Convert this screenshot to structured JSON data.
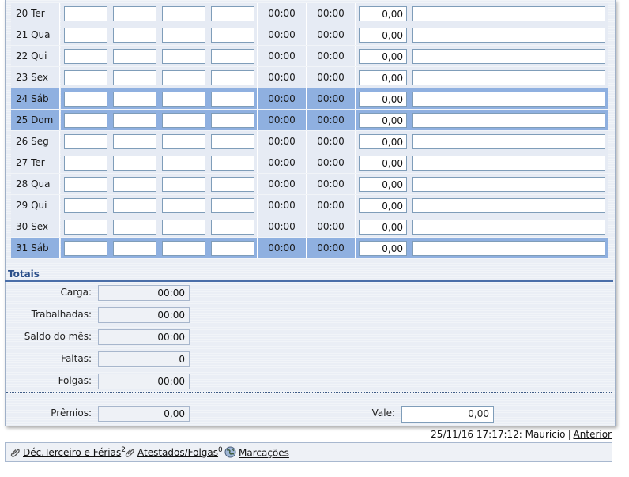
{
  "rows": [
    {
      "day": "20 Ter",
      "t1": "00:00",
      "t2": "00:00",
      "value": "0,00",
      "weekend": false
    },
    {
      "day": "21 Qua",
      "t1": "00:00",
      "t2": "00:00",
      "value": "0,00",
      "weekend": false
    },
    {
      "day": "22 Qui",
      "t1": "00:00",
      "t2": "00:00",
      "value": "0,00",
      "weekend": false
    },
    {
      "day": "23 Sex",
      "t1": "00:00",
      "t2": "00:00",
      "value": "0,00",
      "weekend": false
    },
    {
      "day": "24 Sáb",
      "t1": "00:00",
      "t2": "00:00",
      "value": "0,00",
      "weekend": true
    },
    {
      "day": "25 Dom",
      "t1": "00:00",
      "t2": "00:00",
      "value": "0,00",
      "weekend": true
    },
    {
      "day": "26 Seg",
      "t1": "00:00",
      "t2": "00:00",
      "value": "0,00",
      "weekend": false
    },
    {
      "day": "27 Ter",
      "t1": "00:00",
      "t2": "00:00",
      "value": "0,00",
      "weekend": false
    },
    {
      "day": "28 Qua",
      "t1": "00:00",
      "t2": "00:00",
      "value": "0,00",
      "weekend": false
    },
    {
      "day": "29 Qui",
      "t1": "00:00",
      "t2": "00:00",
      "value": "0,00",
      "weekend": false
    },
    {
      "day": "30 Sex",
      "t1": "00:00",
      "t2": "00:00",
      "value": "0,00",
      "weekend": false
    },
    {
      "day": "31 Sáb",
      "t1": "00:00",
      "t2": "00:00",
      "value": "0,00",
      "weekend": true
    }
  ],
  "totais": {
    "title": "Totais",
    "carga_label": "Carga:",
    "carga": "00:00",
    "trabalhadas_label": "Trabalhadas:",
    "trabalhadas": "00:00",
    "saldo_label": "Saldo do mês:",
    "saldo": "00:00",
    "faltas_label": "Faltas:",
    "faltas": "0",
    "folgas_label": "Folgas:",
    "folgas": "00:00",
    "premios_label": "Prêmios:",
    "premios": "0,00",
    "vale_label": "Vale:",
    "vale": "0,00"
  },
  "status": {
    "text": "25/11/16 17:17:12: Mauricio",
    "separator": "|",
    "anterior": "Anterior"
  },
  "footer": {
    "link1": "Déc.Terceiro e Férias",
    "link1_count": "2",
    "link2": "Atestados/Folgas",
    "link2_count": "0",
    "link3": "Marcações"
  },
  "colors": {
    "weekday_row": "#e6ebf4",
    "weekend_row": "#8fb0e0",
    "accent": "#2b4f8a"
  },
  "icons": {
    "link1": "paperclip-icon",
    "link2": "paperclip-icon",
    "link3": "globe-icon"
  }
}
